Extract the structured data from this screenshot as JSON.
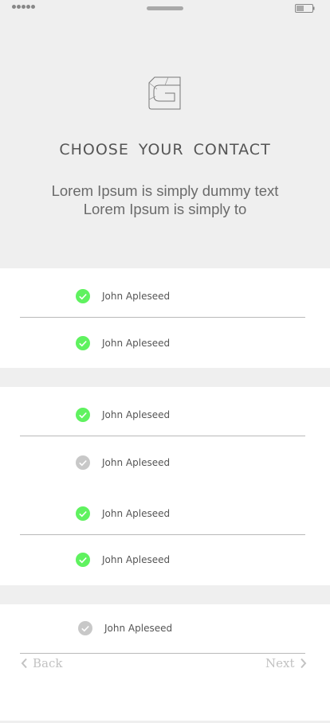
{
  "header": {
    "title": "CHOOSE YOUR CONTACT",
    "subtitle_line1": "Lorem Ipsum is simply dummy text",
    "subtitle_line2": "Lorem Ipsum is simply to"
  },
  "contacts": [
    {
      "name": "John Apleseed",
      "selected": true
    },
    {
      "name": "John Apleseed",
      "selected": true
    },
    {
      "name": "John Apleseed",
      "selected": true
    },
    {
      "name": "John Apleseed",
      "selected": false
    },
    {
      "name": "John Apleseed",
      "selected": true
    },
    {
      "name": "John Apleseed",
      "selected": true
    },
    {
      "name": "John Apleseed",
      "selected": false
    }
  ],
  "nav": {
    "back_label": "Back",
    "next_label": "Next"
  },
  "colors": {
    "check_selected": "#5ff25f",
    "check_unselected": "#c8c8c8",
    "band": "#efefef"
  }
}
